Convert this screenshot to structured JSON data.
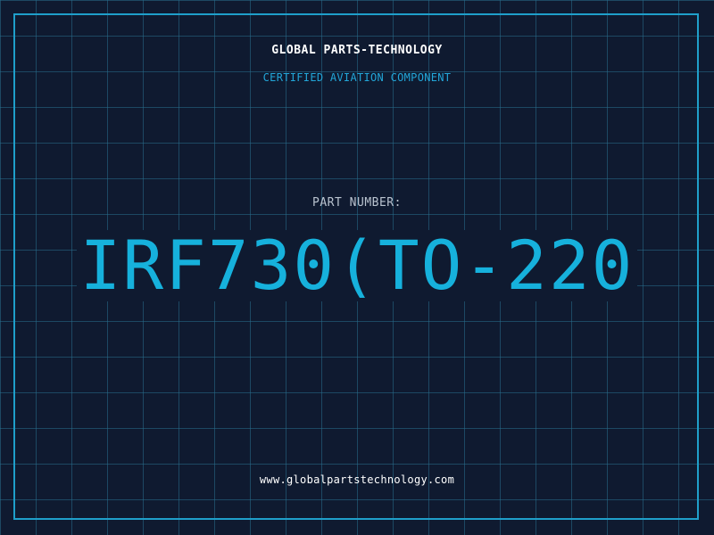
{
  "header": {
    "company": "GLOBAL PARTS-TECHNOLOGY",
    "subtitle": "CERTIFIED AVIATION COMPONENT"
  },
  "part": {
    "label": "PART NUMBER:",
    "number": "IRF730(TO-220"
  },
  "footer": {
    "website": "www.globalpartstechnology.com"
  },
  "colors": {
    "background": "#0f1a30",
    "grid": "#286e8c",
    "frame": "#1f9fca",
    "accent": "#16b1dc",
    "title_text": "#ffffff",
    "label_text": "#b9c3cf"
  }
}
